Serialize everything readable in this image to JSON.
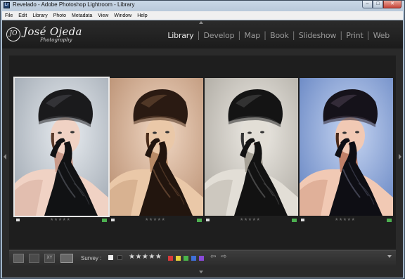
{
  "window": {
    "title": "Revelado - Adobe Photoshop Lightroom - Library",
    "app_icon_label": "Lr",
    "min_label": "–",
    "max_label": "□",
    "close_label": "✕"
  },
  "menu": [
    "File",
    "Edit",
    "Library",
    "Photo",
    "Metadata",
    "View",
    "Window",
    "Help"
  ],
  "identity_plate": {
    "mark": "JO",
    "name": "José Ojeda",
    "sub": "Photography"
  },
  "modules": [
    {
      "label": "Library",
      "active": true
    },
    {
      "label": "Develop",
      "active": false
    },
    {
      "label": "Map",
      "active": false
    },
    {
      "label": "Book",
      "active": false
    },
    {
      "label": "Slideshow",
      "active": false
    },
    {
      "label": "Print",
      "active": false
    },
    {
      "label": "Web",
      "active": false
    }
  ],
  "photos": [
    {
      "variant": "cool-gray",
      "selected": true,
      "stars": "★★★★★"
    },
    {
      "variant": "sepia",
      "selected": false,
      "stars": "★★★★★"
    },
    {
      "variant": "bw",
      "selected": false,
      "stars": "★★★★★"
    },
    {
      "variant": "blue-warm",
      "selected": false,
      "stars": "★★★★★"
    }
  ],
  "toolbar": {
    "survey_label": "Survey :",
    "xy_label": "XY",
    "stars": "★★★★★",
    "prev_label": "⇦",
    "next_label": "⇨",
    "color_labels": [
      "#d83a3a",
      "#e6d23a",
      "#4ab54a",
      "#3f6fd8",
      "#8a4ad8"
    ]
  },
  "colors": {
    "badge": "#4caf50",
    "background": "#1e1e1e"
  }
}
